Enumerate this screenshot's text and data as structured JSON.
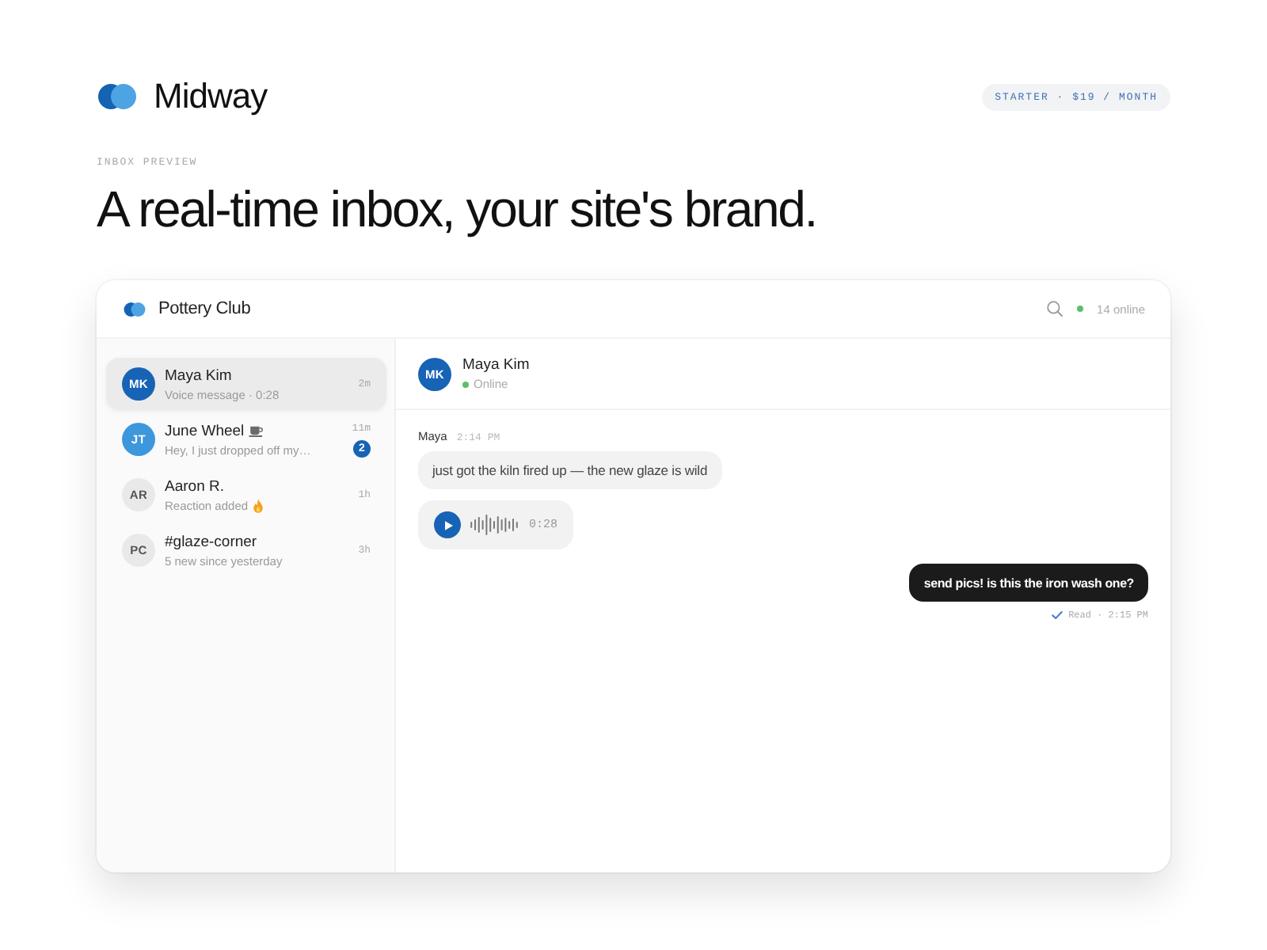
{
  "header": {
    "brand": "Midway",
    "plan": "STARTER · $19 / MONTH"
  },
  "hero": {
    "eyebrow": "INBOX PREVIEW",
    "headline": "A real-time inbox, your site's brand."
  },
  "inbox": {
    "title": "Pottery Club",
    "online_count": "14 online",
    "conversations": [
      {
        "initials": "MK",
        "name": "Maya Kim",
        "preview": "Voice message · 0:28",
        "time": "2m",
        "color": "#1763b5",
        "selected": true,
        "name_icon": false,
        "preview_icon": false
      },
      {
        "initials": "JT",
        "name": "June Wheel",
        "preview": "Hey, I just dropped off my…",
        "time": "11m",
        "unread": "2",
        "color": "#3d97dc",
        "selected": false,
        "name_icon": true,
        "preview_icon": false
      },
      {
        "initials": "AR",
        "name": "Aaron R.",
        "preview": "Reaction added",
        "time": "1h",
        "color": "#e9e9e9",
        "selected": false,
        "name_icon": false,
        "preview_icon": true
      },
      {
        "initials": "PC",
        "name": "#glaze-corner",
        "preview": "5 new since yesterday",
        "time": "3h",
        "color": "#e9e9e9",
        "selected": false,
        "name_icon": false,
        "preview_icon": false
      }
    ],
    "chat": {
      "contact": {
        "initials": "MK",
        "name": "Maya Kim",
        "status": "Online",
        "online": true,
        "color": "#1763b5"
      },
      "messages": [
        {
          "kind": "text",
          "outgoing": false,
          "sender": "Maya",
          "time": "2:14 PM",
          "text": "just got the kiln fired up — the new glaze is wild"
        },
        {
          "kind": "voice",
          "outgoing": false,
          "duration": "0:28"
        },
        {
          "kind": "text",
          "outgoing": true,
          "text": "send pics! is this the iron wash one?",
          "receipt": "Read · 2:15 PM"
        }
      ]
    }
  }
}
